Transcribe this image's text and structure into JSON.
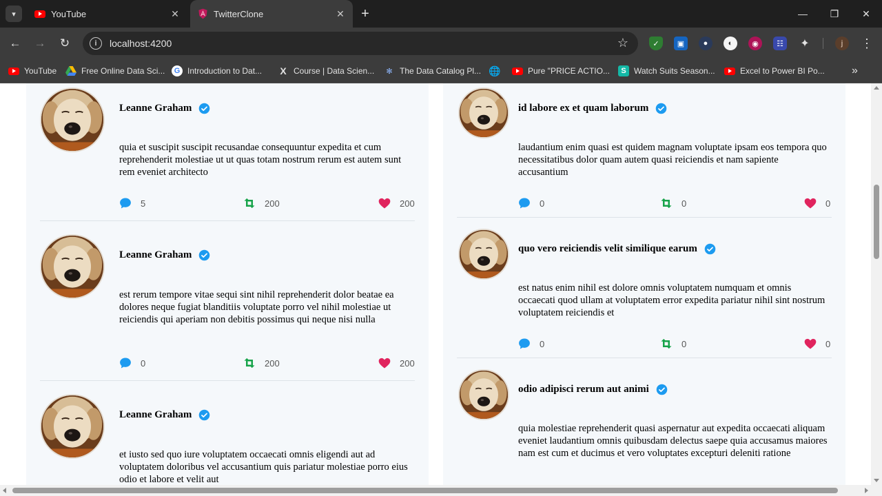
{
  "browser": {
    "tabs": [
      {
        "title": "YouTube",
        "favicon": "youtube-icon",
        "active": false
      },
      {
        "title": "TwitterClone",
        "favicon": "angular-icon",
        "active": true
      }
    ],
    "url": "localhost:4200",
    "bookmarks": [
      {
        "label": "YouTube",
        "icon": "youtube-icon"
      },
      {
        "label": "Free Online Data Sci...",
        "icon": "drive-icon"
      },
      {
        "label": "Introduction to Dat...",
        "icon": "google-icon"
      },
      {
        "label": "Course | Data Scien...",
        "icon": "x-icon"
      },
      {
        "label": "The Data Catalog Pl...",
        "icon": "catalog-icon"
      },
      {
        "label": "",
        "icon": "globe-icon"
      },
      {
        "label": "Pure \"PRICE ACTIO...",
        "icon": "youtube-icon"
      },
      {
        "label": "Watch Suits Season...",
        "icon": "s-icon"
      },
      {
        "label": "Excel to Power BI Po...",
        "icon": "youtube-icon"
      }
    ],
    "profile_initial": "j"
  },
  "colors": {
    "comment": "#1d9bf0",
    "retweet": "#17a34a",
    "like": "#e0245e",
    "verified": "#1d9bf0"
  },
  "feed": {
    "left": [
      {
        "name": "Leanne Graham",
        "body": "quia et suscipit suscipit recusandae consequuntur expedita et cum reprehenderit molestiae ut ut quas totam nostrum rerum est autem sunt rem eveniet architecto",
        "comments": "5",
        "retweets": "200",
        "likes": "200"
      },
      {
        "name": "Leanne Graham",
        "body": "est rerum tempore vitae sequi sint nihil reprehenderit dolor beatae ea dolores neque fugiat blanditiis voluptate porro vel nihil molestiae ut reiciendis qui aperiam non debitis possimus qui neque nisi nulla",
        "comments": "0",
        "retweets": "200",
        "likes": "200"
      },
      {
        "name": "Leanne Graham",
        "body": "et iusto sed quo iure voluptatem occaecati omnis eligendi aut ad voluptatem doloribus vel accusantium quis pariatur molestiae porro eius odio et labore et velit aut"
      }
    ],
    "right": [
      {
        "name": "id labore ex et quam laborum",
        "body": "laudantium enim quasi est quidem magnam voluptate ipsam eos tempora quo necessitatibus dolor quam autem quasi reiciendis et nam sapiente accusantium",
        "comments": "0",
        "retweets": "0",
        "likes": "0"
      },
      {
        "name": "quo vero reiciendis velit similique earum",
        "body": "est natus enim nihil est dolore omnis voluptatem numquam et omnis occaecati quod ullam at voluptatem error expedita pariatur nihil sint nostrum voluptatem reiciendis et",
        "comments": "0",
        "retweets": "0",
        "likes": "0"
      },
      {
        "name": "odio adipisci rerum aut animi",
        "body": "quia molestiae reprehenderit quasi aspernatur aut expedita occaecati aliquam eveniet laudantium omnis quibusdam delectus saepe quia accusamus maiores nam est cum et ducimus et vero voluptates excepturi deleniti ratione"
      }
    ]
  }
}
